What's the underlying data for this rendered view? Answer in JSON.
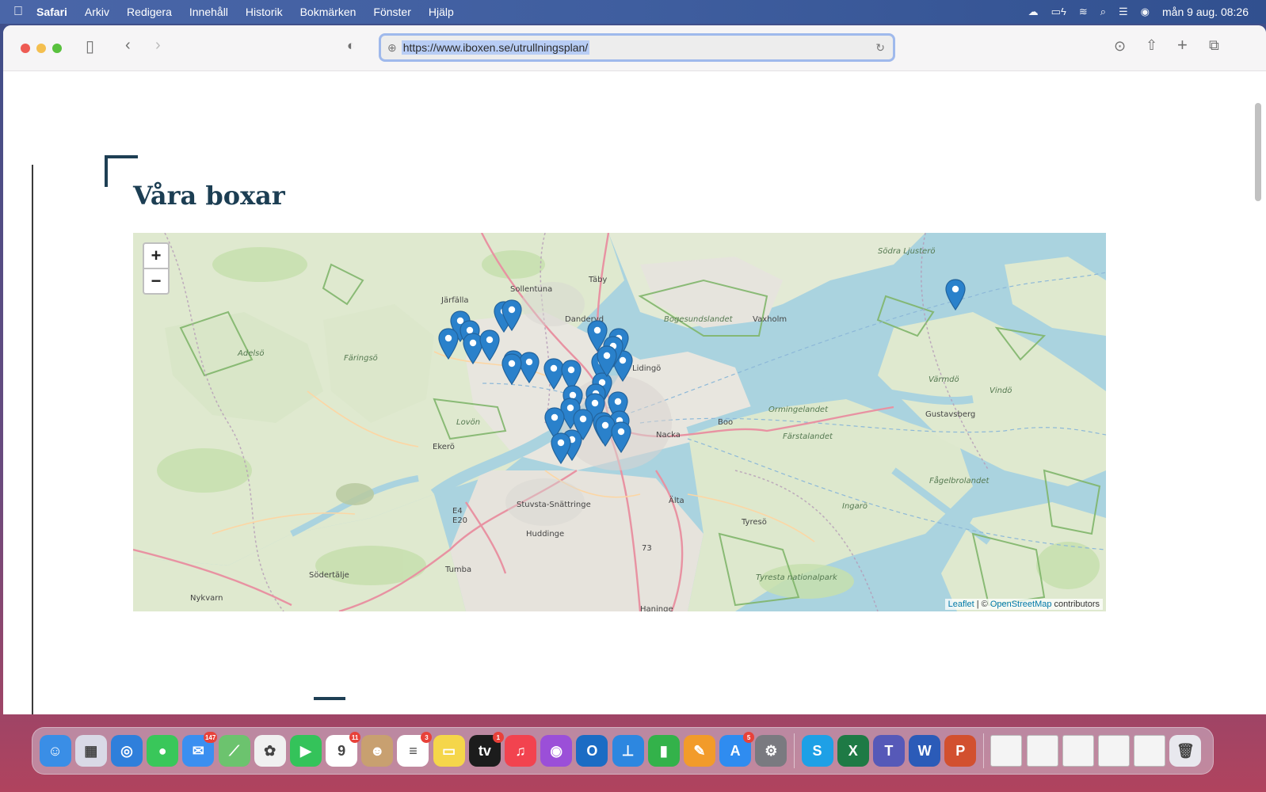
{
  "menubar": {
    "apple": "",
    "items": [
      "Safari",
      "Arkiv",
      "Redigera",
      "Innehåll",
      "Historik",
      "Bokmärken",
      "Fönster",
      "Hjälp"
    ],
    "clock": "mån 9 aug. 08:26",
    "status_icons": [
      "creative-cloud-icon",
      "battery-icon",
      "wifi-icon",
      "spotlight-icon",
      "control-center-icon",
      "siri-icon"
    ]
  },
  "browser": {
    "url": "https://www.iboxen.se/utrullningsplan/"
  },
  "page": {
    "heading": "Våra boxar"
  },
  "map": {
    "zoom_in": "+",
    "zoom_out": "−",
    "attribution_leaflet": "Leaflet",
    "attribution_sep": " | © ",
    "attribution_osm": "OpenStreetMap",
    "attribution_tail": " contributors",
    "places": [
      {
        "name": "Södra Ljusterö",
        "italic": true
      },
      {
        "name": "Sollentuna",
        "italic": false
      },
      {
        "name": "Täby",
        "italic": false
      },
      {
        "name": "Järfälla",
        "italic": false
      },
      {
        "name": "Danderyd",
        "italic": false
      },
      {
        "name": "Bogesundslandet",
        "italic": true
      },
      {
        "name": "Vaxholm",
        "italic": false
      },
      {
        "name": "Adelsö",
        "italic": true
      },
      {
        "name": "Färingsö",
        "italic": true
      },
      {
        "name": "Lidingö",
        "italic": false
      },
      {
        "name": "Värmdö",
        "italic": true
      },
      {
        "name": "Vindö",
        "italic": true
      },
      {
        "name": "Lovön",
        "italic": true
      },
      {
        "name": "Gustavsberg",
        "italic": false
      },
      {
        "name": "Ormingelandet",
        "italic": true
      },
      {
        "name": "Boo",
        "italic": false
      },
      {
        "name": "Nacka",
        "italic": false
      },
      {
        "name": "Ekerö",
        "italic": false
      },
      {
        "name": "Färstalandet",
        "italic": true
      },
      {
        "name": "Fågelbrolandet",
        "italic": true
      },
      {
        "name": "E4",
        "italic": false
      },
      {
        "name": "E20",
        "italic": false
      },
      {
        "name": "Stuvsta-Snättringe",
        "italic": false
      },
      {
        "name": "Älta",
        "italic": false
      },
      {
        "name": "Ingarö",
        "italic": true
      },
      {
        "name": "Huddinge",
        "italic": false
      },
      {
        "name": "Tyresö",
        "italic": false
      },
      {
        "name": "73",
        "italic": false
      },
      {
        "name": "Tumba",
        "italic": false
      },
      {
        "name": "Södertälje",
        "italic": false
      },
      {
        "name": "Nykvarn",
        "italic": false
      },
      {
        "name": "Tyresta nationalpark",
        "italic": true
      },
      {
        "name": "Haninge",
        "italic": false
      }
    ]
  },
  "dock": {
    "apps": [
      {
        "name": "finder-icon",
        "color": "#3a8ee6",
        "glyph": "☺",
        "badge": ""
      },
      {
        "name": "launchpad-icon",
        "color": "#d9d9e6",
        "glyph": "▦",
        "badge": ""
      },
      {
        "name": "safari-icon",
        "color": "#2f7fdb",
        "glyph": "◎",
        "badge": ""
      },
      {
        "name": "messages-icon",
        "color": "#39c75a",
        "glyph": "●",
        "badge": ""
      },
      {
        "name": "mail-icon",
        "color": "#3b8ff0",
        "glyph": "✉",
        "badge": "147"
      },
      {
        "name": "maps-icon",
        "color": "#6cc36e",
        "glyph": "⟋",
        "badge": ""
      },
      {
        "name": "photos-icon",
        "color": "#f0f0f0",
        "glyph": "✿",
        "badge": ""
      },
      {
        "name": "facetime-icon",
        "color": "#34c35a",
        "glyph": "▶",
        "badge": ""
      },
      {
        "name": "calendar-icon",
        "color": "#ffffff",
        "glyph": "9",
        "badge": "11"
      },
      {
        "name": "contacts-icon",
        "color": "#c8a070",
        "glyph": "☻",
        "badge": ""
      },
      {
        "name": "reminders-icon",
        "color": "#ffffff",
        "glyph": "≡",
        "badge": "3"
      },
      {
        "name": "notes-icon",
        "color": "#f5d64a",
        "glyph": "▭",
        "badge": ""
      },
      {
        "name": "appletv-icon",
        "color": "#1c1c1c",
        "glyph": "tv",
        "badge": "1"
      },
      {
        "name": "music-icon",
        "color": "#f2434f",
        "glyph": "♫",
        "badge": ""
      },
      {
        "name": "podcasts-icon",
        "color": "#9b4fd8",
        "glyph": "◉",
        "badge": ""
      },
      {
        "name": "outlook-icon",
        "color": "#1b6cc4",
        "glyph": "O",
        "badge": ""
      },
      {
        "name": "keynote-icon",
        "color": "#2d87e0",
        "glyph": "⊥",
        "badge": ""
      },
      {
        "name": "numbers-icon",
        "color": "#33b24a",
        "glyph": "▮",
        "badge": ""
      },
      {
        "name": "pages-icon",
        "color": "#f29b2a",
        "glyph": "✎",
        "badge": ""
      },
      {
        "name": "appstore-icon",
        "color": "#2f8cf0",
        "glyph": "A",
        "badge": "5"
      },
      {
        "name": "system-preferences-icon",
        "color": "#7a7a80",
        "glyph": "⚙",
        "badge": ""
      },
      {
        "name": "skype-icon",
        "color": "#1ea0e6",
        "glyph": "S",
        "badge": ""
      },
      {
        "name": "excel-icon",
        "color": "#1e7a45",
        "glyph": "X",
        "badge": ""
      },
      {
        "name": "teams-icon",
        "color": "#5659b8",
        "glyph": "T",
        "badge": ""
      },
      {
        "name": "word-icon",
        "color": "#2b5bb8",
        "glyph": "W",
        "badge": ""
      },
      {
        "name": "powerpoint-icon",
        "color": "#d2502f",
        "glyph": "P",
        "badge": ""
      },
      {
        "name": "window-thumb-icon",
        "color": "#f4f4f4",
        "glyph": "",
        "badge": ""
      },
      {
        "name": "window-thumb-icon",
        "color": "#f4f4f4",
        "glyph": "",
        "badge": ""
      },
      {
        "name": "window-thumb-icon",
        "color": "#f4f4f4",
        "glyph": "",
        "badge": ""
      },
      {
        "name": "window-thumb-icon",
        "color": "#f4f4f4",
        "glyph": "",
        "badge": ""
      },
      {
        "name": "window-thumb-icon",
        "color": "#f4f4f4",
        "glyph": "",
        "badge": ""
      },
      {
        "name": "trash-icon",
        "color": "#e8e8ee",
        "glyph": "🗑",
        "badge": ""
      }
    ]
  },
  "colors": {
    "heading": "#1c3e53",
    "marker": "#2a81cb",
    "water": "#aad3df",
    "land": "#dfe9cf"
  }
}
